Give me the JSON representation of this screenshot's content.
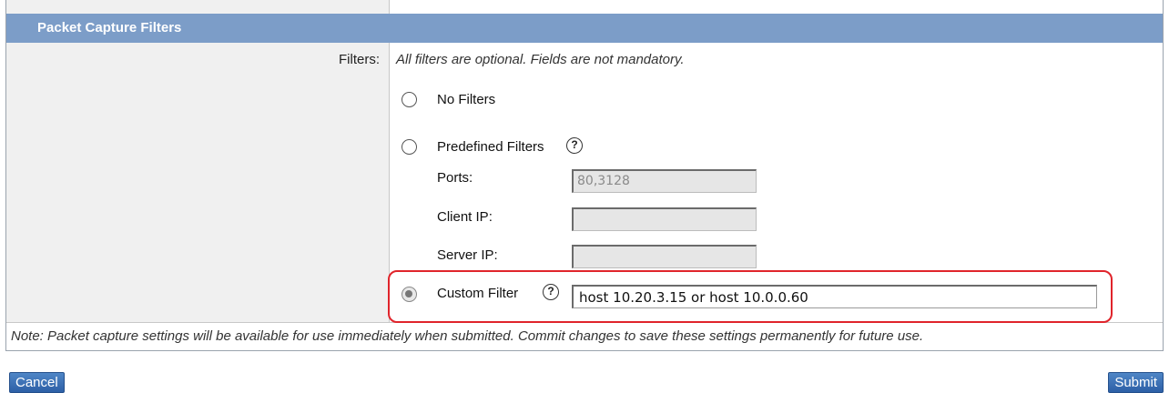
{
  "section": {
    "title": "Packet Capture Filters"
  },
  "filters": {
    "label": "Filters:",
    "hint": "All filters are optional. Fields are not mandatory.",
    "options": {
      "no_filters": {
        "label": "No Filters",
        "selected": false
      },
      "predefined": {
        "label": "Predefined Filters",
        "selected": false,
        "ports_label": "Ports:",
        "ports_value": "80,3128",
        "client_ip_label": "Client IP:",
        "client_ip_value": "",
        "server_ip_label": "Server IP:",
        "server_ip_value": ""
      },
      "custom": {
        "label": "Custom Filter",
        "selected": true,
        "value": "host 10.20.3.15 or host 10.0.0.60"
      }
    },
    "help_glyph": "?"
  },
  "note": "Note: Packet capture settings will be available for use immediately when submitted. Commit changes to save these settings permanently for future use.",
  "buttons": {
    "cancel": "Cancel",
    "submit": "Submit"
  },
  "colors": {
    "header_bg": "#7c9dc8",
    "highlight": "#e0242b",
    "button_bg": "#3a6fb5"
  }
}
